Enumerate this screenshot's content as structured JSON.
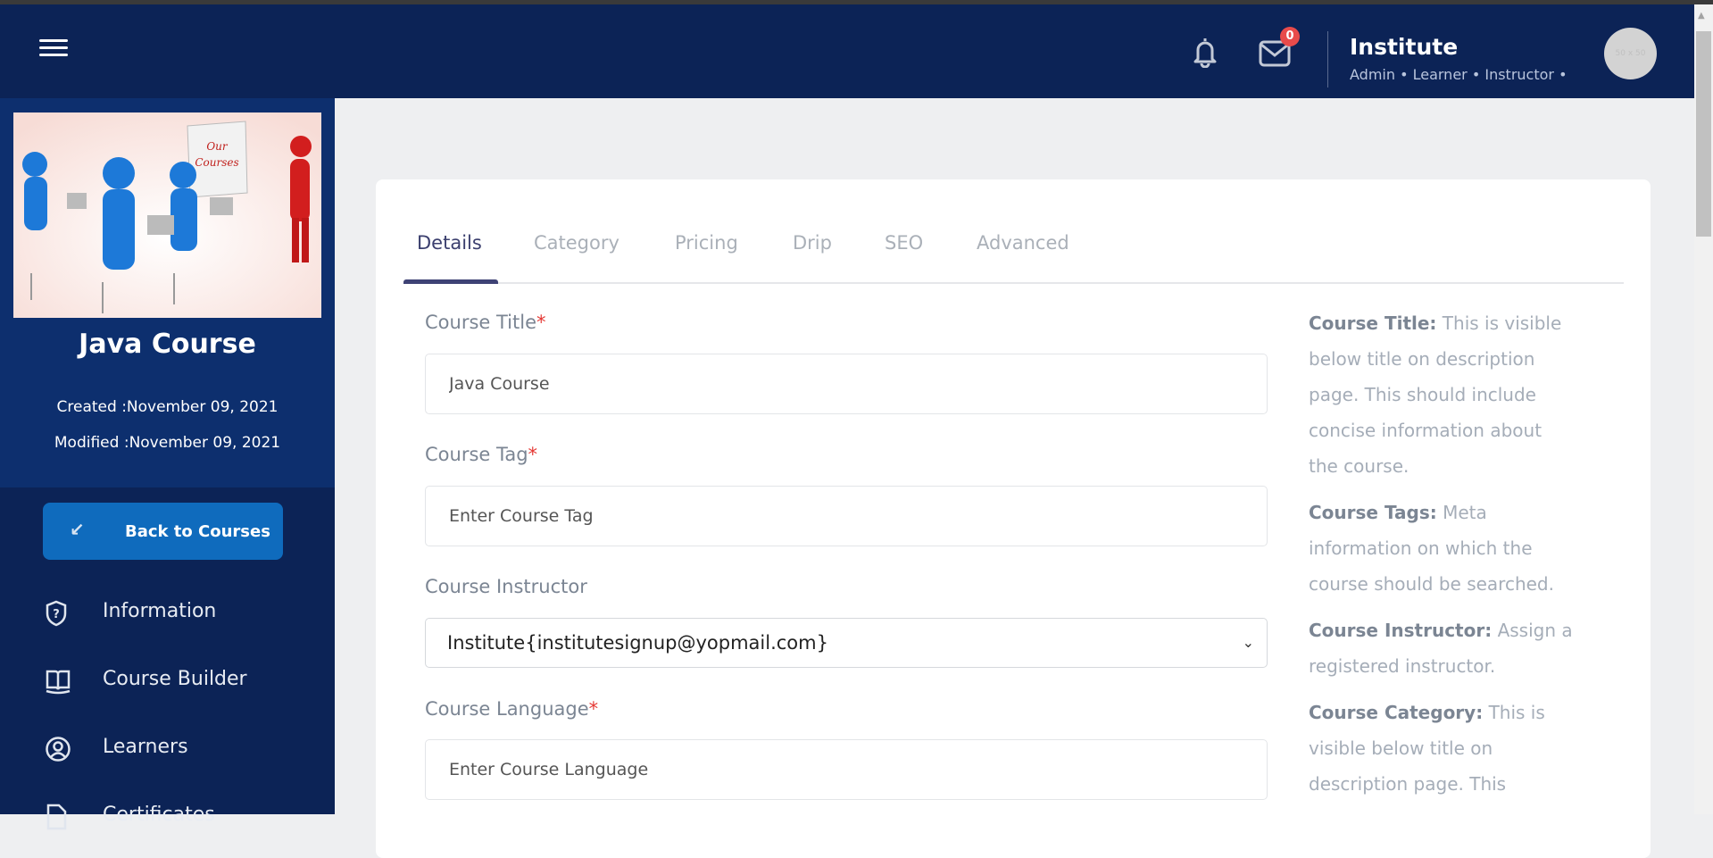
{
  "header": {
    "notification_count": "0",
    "user_name": "Institute",
    "user_roles": "Admin • Learner • Instructor •",
    "avatar_placeholder": "50 x 50"
  },
  "sidebar": {
    "course_image_text": "Our Courses",
    "course_title": "Java Course",
    "created": "Created :November 09, 2021",
    "modified": "Modified :November 09, 2021",
    "back_button": "Back to Courses",
    "items": [
      {
        "label": "Information"
      },
      {
        "label": "Course Builder"
      },
      {
        "label": "Learners"
      },
      {
        "label": "Certificates"
      }
    ]
  },
  "tabs": [
    {
      "label": "Details"
    },
    {
      "label": "Category"
    },
    {
      "label": "Pricing"
    },
    {
      "label": "Drip"
    },
    {
      "label": "SEO"
    },
    {
      "label": "Advanced"
    }
  ],
  "form": {
    "title_label": "Course Title",
    "title_value": "Java Course",
    "tag_label": "Course Tag",
    "tag_placeholder": "Enter Course Tag",
    "instructor_label": "Course Instructor",
    "instructor_value": "Institute{institutesignup@yopmail.com}",
    "language_label": "Course Language",
    "language_placeholder": "Enter Course Language",
    "required_mark": "*"
  },
  "help": [
    {
      "term": "Course Title:",
      "text": " This is visible below title on description page. This should include concise information about the course."
    },
    {
      "term": "Course Tags:",
      "text": " Meta information on which the course should be searched."
    },
    {
      "term": "Course Instructor:",
      "text": " Assign a registered instructor."
    },
    {
      "term": "Course Category:",
      "text": " This is visible below title on description page. This"
    }
  ]
}
